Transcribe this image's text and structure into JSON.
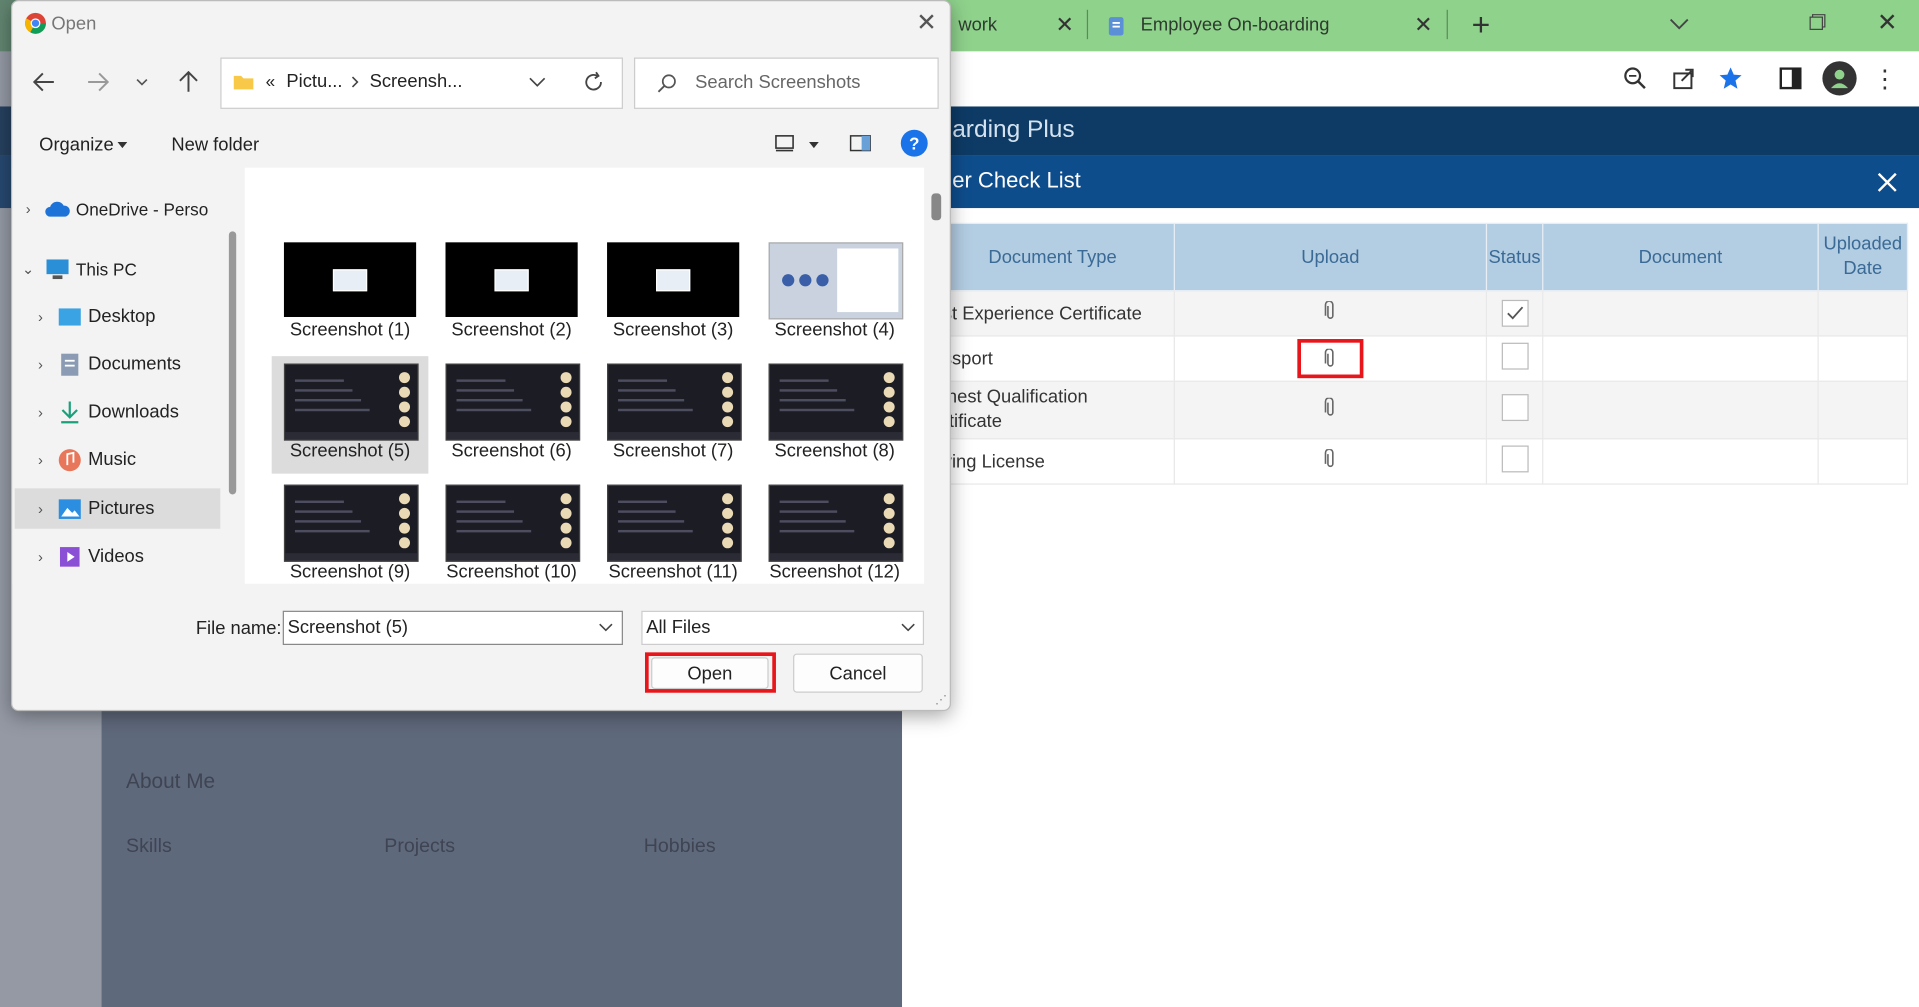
{
  "browser": {
    "tabs": [
      {
        "label": "work"
      },
      {
        "label": "Employee On-boarding"
      }
    ],
    "new_tab_symbol": "+",
    "toolbar_icons": [
      "zoom-icon",
      "share-icon",
      "bookmark-star-icon",
      "side-panel-icon",
      "profile-icon",
      "menu-icon"
    ],
    "accent_color": "#8fd28c"
  },
  "app": {
    "title": "arding Plus",
    "modal_title": "er Check List",
    "table": {
      "headers": [
        "Document Type",
        "Upload",
        "Status",
        "Document",
        "Uploaded Date"
      ],
      "rows": [
        {
          "document_type": "ast Experience Certificate",
          "checked": true
        },
        {
          "document_type": "assport",
          "checked": false,
          "highlighted": true
        },
        {
          "document_type": "ighest Qualification\nertificate",
          "checked": false
        },
        {
          "document_type": "riving License",
          "checked": false
        }
      ]
    }
  },
  "profile": {
    "section_title": "About Me",
    "links": [
      "Skills",
      "Projects",
      "Hobbies"
    ]
  },
  "dialog": {
    "title": "Open",
    "breadcrumb": {
      "prefix": "«",
      "parts": [
        "Pictu...",
        "Screensh..."
      ]
    },
    "search_placeholder": "Search Screenshots",
    "organize_label": "Organize",
    "new_folder_label": "New folder",
    "nav": [
      {
        "label": "OneDrive - Perso",
        "icon": "cloud-icon",
        "indent": 0
      },
      {
        "label": "This PC",
        "icon": "pc-icon",
        "indent": 0,
        "expanded": true
      },
      {
        "label": "Desktop",
        "icon": "desktop-icon",
        "indent": 1
      },
      {
        "label": "Documents",
        "icon": "documents-icon",
        "indent": 1
      },
      {
        "label": "Downloads",
        "icon": "download-icon",
        "indent": 1
      },
      {
        "label": "Music",
        "icon": "music-icon",
        "indent": 1
      },
      {
        "label": "Pictures",
        "icon": "pictures-icon",
        "indent": 1,
        "selected": true
      },
      {
        "label": "Videos",
        "icon": "videos-icon",
        "indent": 1
      }
    ],
    "files": [
      "Screenshot (1)",
      "Screenshot (2)",
      "Screenshot (3)",
      "Screenshot (4)",
      "Screenshot (5)",
      "Screenshot (6)",
      "Screenshot (7)",
      "Screenshot (8)",
      "Screenshot (9)",
      "Screenshot (10)",
      "Screenshot (11)",
      "Screenshot (12)"
    ],
    "selected_file": "Screenshot (5)",
    "file_name_label": "File name:",
    "file_name_value": "Screenshot (5)",
    "file_type_value": "All Files",
    "open_label": "Open",
    "cancel_label": "Cancel",
    "highlight_color": "#e8161b"
  }
}
